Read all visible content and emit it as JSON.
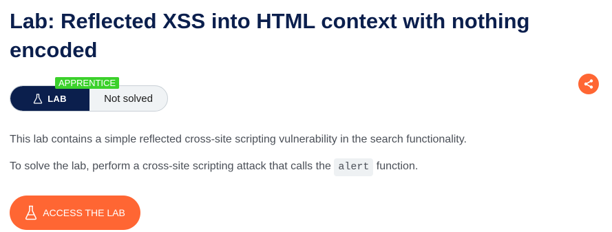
{
  "lab": {
    "title": "Lab: Reflected XSS into HTML context with nothing encoded",
    "level": "APPRENTICE",
    "badge_label": "LAB",
    "status": "Not solved",
    "description_1": "This lab contains a simple reflected cross-site scripting vulnerability in the search functionality.",
    "description_2_before": "To solve the lab, perform a cross-site scripting attack that calls the",
    "description_2_code": "alert",
    "description_2_after": "function.",
    "access_button_label": "ACCESS THE LAB"
  },
  "colors": {
    "title": "#0b1f4d",
    "accent": "#ff6633",
    "level_tag": "#3bd12b",
    "lab_badge": "#0b1f4d"
  },
  "icons": {
    "share": "share-icon",
    "flask": "flask-icon"
  }
}
